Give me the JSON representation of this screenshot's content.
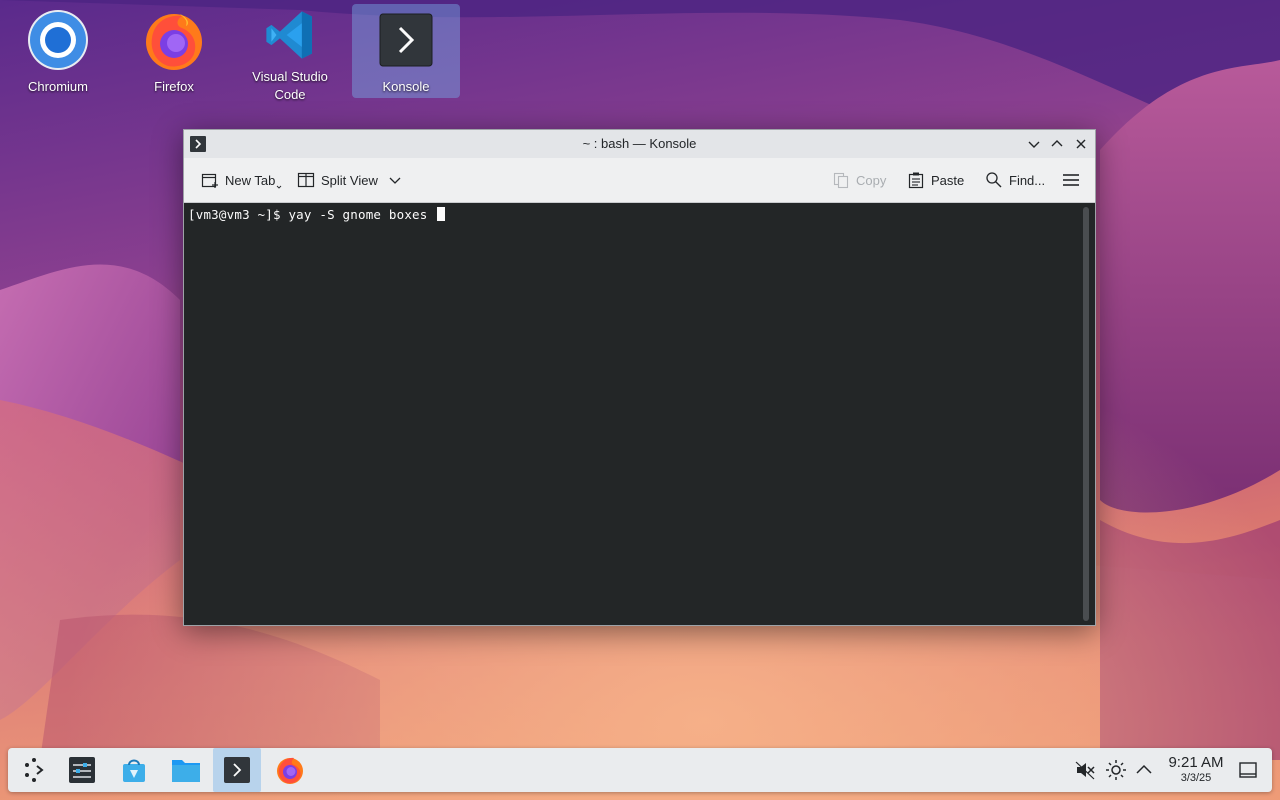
{
  "desktop": {
    "icons": [
      {
        "label": "Chromium",
        "icon": "chromium-icon"
      },
      {
        "label": "Firefox",
        "icon": "firefox-icon"
      },
      {
        "label": "Visual Studio Code",
        "icon": "vscode-icon"
      },
      {
        "label": "Konsole",
        "icon": "konsole-icon",
        "selected": true
      }
    ]
  },
  "window": {
    "title": "~ : bash — Konsole",
    "toolbar": {
      "new_tab": "New Tab",
      "split_view": "Split View",
      "copy": "Copy",
      "paste": "Paste",
      "find": "Find..."
    },
    "terminal": {
      "prompt": "[vm3@vm3 ~]$ ",
      "command": "yay -S gnome boxes "
    }
  },
  "taskbar": {
    "items": [
      "app-launcher-icon",
      "system-settings-icon",
      "discover-store-icon",
      "file-manager-icon",
      "konsole-icon",
      "firefox-icon"
    ],
    "active": "konsole-icon",
    "tray": [
      "volume-muted-icon",
      "brightness-icon",
      "show-hidden-icons-chevron-icon"
    ],
    "clock": {
      "time": "9:21 AM",
      "date": "3/3/25"
    }
  },
  "colors": {
    "terminal_bg": "#232627",
    "terminal_fg": "#fcfcfc",
    "selection": "#b8d3ec",
    "window_bg": "#eff0f1"
  }
}
